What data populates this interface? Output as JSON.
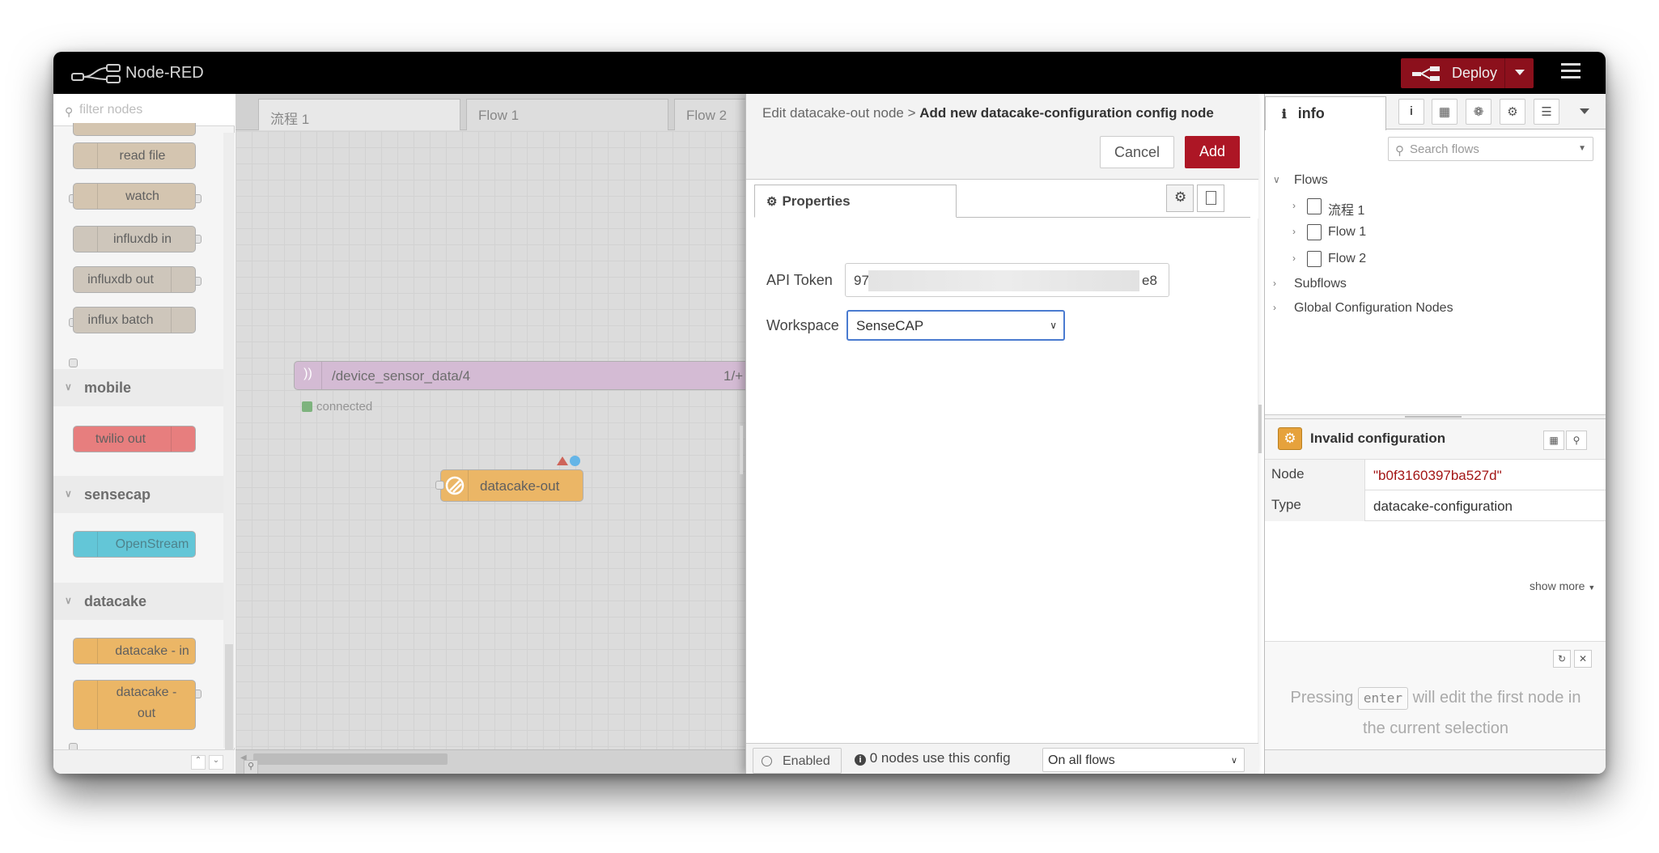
{
  "header": {
    "app_title": "Node-RED",
    "deploy_label": "Deploy"
  },
  "palette": {
    "filter_placeholder": "filter nodes",
    "nodes_storage": [
      "read file",
      "watch"
    ],
    "nodes_influx": [
      "influxdb in",
      "influxdb out",
      "influx batch"
    ],
    "categories": {
      "mobile": "mobile",
      "sensecap": "sensecap",
      "datacake": "datacake"
    },
    "mobile_nodes": [
      "twilio out"
    ],
    "sensecap_nodes": [
      "OpenStream"
    ],
    "datacake_nodes": [
      "datacake - in",
      "datacake -",
      "out"
    ]
  },
  "workspace": {
    "tabs": [
      "流程 1",
      "Flow 1",
      "Flow 2"
    ],
    "mqtt_node_label": "/device_sensor_data/4",
    "mqtt_node_suffix": "1/+",
    "mqtt_status": "connected",
    "datacake_out_label": "datacake-out"
  },
  "tray": {
    "breadcrumb": "Edit datacake-out node >",
    "title": "Add new datacake-configuration config node",
    "cancel_label": "Cancel",
    "add_label": "Add",
    "properties_tab": "Properties",
    "api_token_label": "API Token",
    "api_token_start": "97",
    "api_token_end": "e8",
    "workspace_label": "Workspace",
    "workspace_value": "SenseCAP",
    "enabled_label": "Enabled",
    "usage_text": "0 nodes use this config",
    "scope_value": "On all flows"
  },
  "sidebar": {
    "info_tab": "info",
    "search_placeholder": "Search flows",
    "tree": {
      "flows": "Flows",
      "flow_items": [
        "流程 1",
        "Flow 1",
        "Flow 2"
      ],
      "subflows": "Subflows",
      "global_config": "Global Configuration Nodes"
    },
    "selection_title": "Invalid configuration",
    "props": {
      "node_key": "Node",
      "node_value": "\"b0f3160397ba527d\"",
      "type_key": "Type",
      "type_value": "datacake-configuration"
    },
    "show_more": "show more",
    "help_before": "Pressing",
    "help_key": "enter",
    "help_after": "will edit the first node in the current selection"
  },
  "colors": {
    "header_bg": "#000000",
    "deploy_bg": "#8c101c",
    "add_button": "#ad1625",
    "datacake_node": "#e6a23c",
    "twilio_node": "#e05a5a",
    "openstream_node": "#38b6cc",
    "mqtt_node": "#c8a8c8"
  }
}
